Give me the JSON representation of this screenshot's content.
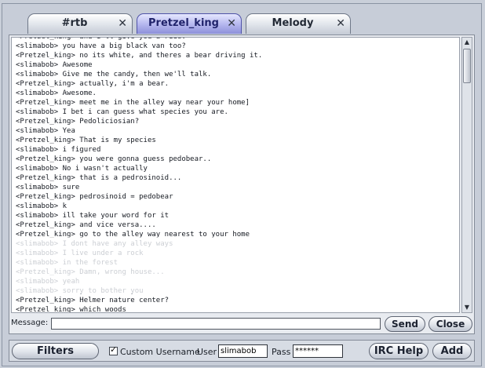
{
  "tabs": [
    {
      "label": "#rtb",
      "close": "✕",
      "active": false
    },
    {
      "label": "Pretzel_king",
      "close": "✕",
      "active": true
    },
    {
      "label": "Melody",
      "close": "✕",
      "active": false
    }
  ],
  "chat": {
    "lines": [
      {
        "text": "<Pretzel_king> and i'll give you a ride.",
        "faded": false
      },
      {
        "text": "<slimabob> you have a big black van too?",
        "faded": false
      },
      {
        "text": "<Pretzel_king> no its white, and theres a bear driving it.",
        "faded": false
      },
      {
        "text": "<slimabob> Awesome",
        "faded": false
      },
      {
        "text": "<slimabob> Give me the candy, then we'll talk.",
        "faded": false
      },
      {
        "text": "<Pretzel_king> actually, i'm a bear.",
        "faded": false
      },
      {
        "text": "<slimabob> Awesome.",
        "faded": false
      },
      {
        "text": "<Pretzel_king> meet me in the alley way near your home]",
        "faded": false
      },
      {
        "text": "<slimabob> I bet i can guess what species you are.",
        "faded": false
      },
      {
        "text": "<Pretzel_king> Pedoliciosian?",
        "faded": false
      },
      {
        "text": "<slimabob> Yea",
        "faded": false
      },
      {
        "text": "<Pretzel_king> That is my species",
        "faded": false
      },
      {
        "text": "<slimabob> i figured",
        "faded": false
      },
      {
        "text": "<Pretzel_king> you were gonna guess pedobear..",
        "faded": false
      },
      {
        "text": "<slimabob> No i wasn't actually",
        "faded": false
      },
      {
        "text": "<Pretzel_king> that is a pedrosinoid...",
        "faded": false
      },
      {
        "text": "<slimabob> sure",
        "faded": false
      },
      {
        "text": "<Pretzel_king> pedrosinoid = pedobear",
        "faded": false
      },
      {
        "text": "<slimabob> k",
        "faded": false
      },
      {
        "text": "<slimabob> ill take your word for it",
        "faded": false
      },
      {
        "text": "<Pretzel_king> and vice versa....",
        "faded": false
      },
      {
        "text": "<Pretzel_king> go to the alley way nearest to your home",
        "faded": false
      },
      {
        "text": "<slimabob> I dont have any alley ways",
        "faded": true
      },
      {
        "text": "<slimabob> I live under a rock",
        "faded": true
      },
      {
        "text": "<slimabob> in the forest",
        "faded": true
      },
      {
        "text": "<Pretzel_king> Damn, wrong house...",
        "faded": true
      },
      {
        "text": "<slimabob> yeah",
        "faded": true
      },
      {
        "text": "<slimabob> sorry to bother you",
        "faded": true
      },
      {
        "text": "<Pretzel_king> Helmer nature center?",
        "faded": false
      },
      {
        "text": "<Pretzel_king> which woods",
        "faded": false
      }
    ]
  },
  "scrollbar": {
    "up_arrow": "▲",
    "down_arrow": "▼"
  },
  "message": {
    "label": "Message:",
    "value": "",
    "send_label": "Send",
    "close_label": "Close"
  },
  "bottom": {
    "filters_label": "Filters",
    "custom_username_label": "Custom Username",
    "custom_username_checked": true,
    "check_mark": "✓",
    "user_label": "User",
    "user_value": "slimabob",
    "pass_label": "Pass",
    "pass_value": "******",
    "irchelp_label": "IRC Help",
    "add_label": "Add"
  },
  "colors": {
    "background": "#c9cfd9",
    "active_tab": "#9a9de0",
    "inactive_tab": "#dfe3ea",
    "chat_text": "#161a22",
    "faded_text": "#8c939e"
  }
}
